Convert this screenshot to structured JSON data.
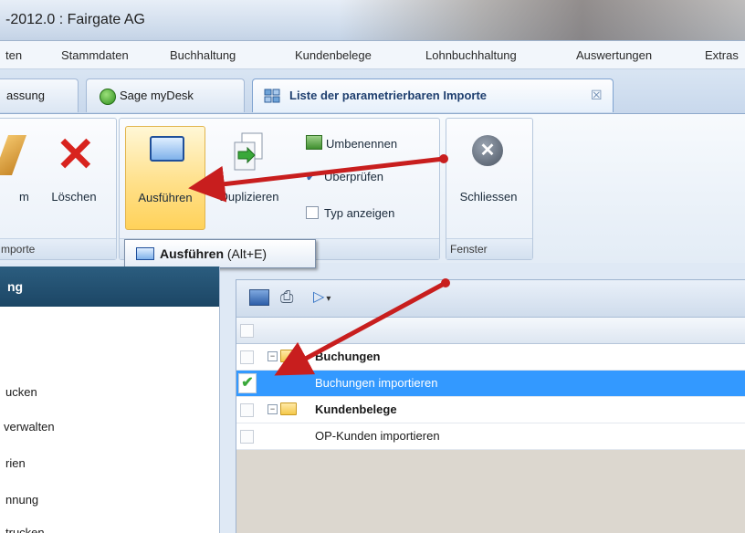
{
  "window": {
    "title": "-2012.0 : Fairgate AG"
  },
  "menu": {
    "items": [
      "ten",
      "Stammdaten",
      "Buchhaltung",
      "Kundenbelege",
      "Lohnbuchhaltung",
      "Auswertungen",
      "Extras"
    ]
  },
  "tabs": [
    {
      "label": "assung"
    },
    {
      "label": "Sage myDesk"
    },
    {
      "label": "Liste der parametrierbaren Importe"
    }
  ],
  "ribbon": {
    "rename_partial": "m",
    "delete": "Löschen",
    "execute": "Ausführen",
    "duplicate": "Duplizieren",
    "rename": "Umbenennen",
    "check": "Überprüfen",
    "show_type": "Typ anzeigen",
    "close": "Schliessen",
    "group_imports": "mporte",
    "group_window": "Fenster"
  },
  "tooltip": {
    "label": "Ausführen",
    "shortcut": "(Alt+E)"
  },
  "leftnav": {
    "header": "ng",
    "items": [
      "ucken",
      "verwalten",
      "rien",
      "nnung",
      "trucken"
    ]
  },
  "grid": {
    "rows": [
      {
        "label": "Buchungen",
        "type": "group"
      },
      {
        "label": "Buchungen importieren",
        "type": "item",
        "selected": true
      },
      {
        "label": "Kundenbelege",
        "type": "group"
      },
      {
        "label": "OP-Kunden importieren",
        "type": "item"
      }
    ]
  },
  "colors": {
    "selection": "#3399ff",
    "accent_arrow": "#c81e1e",
    "nav_header": "#1c4665"
  }
}
